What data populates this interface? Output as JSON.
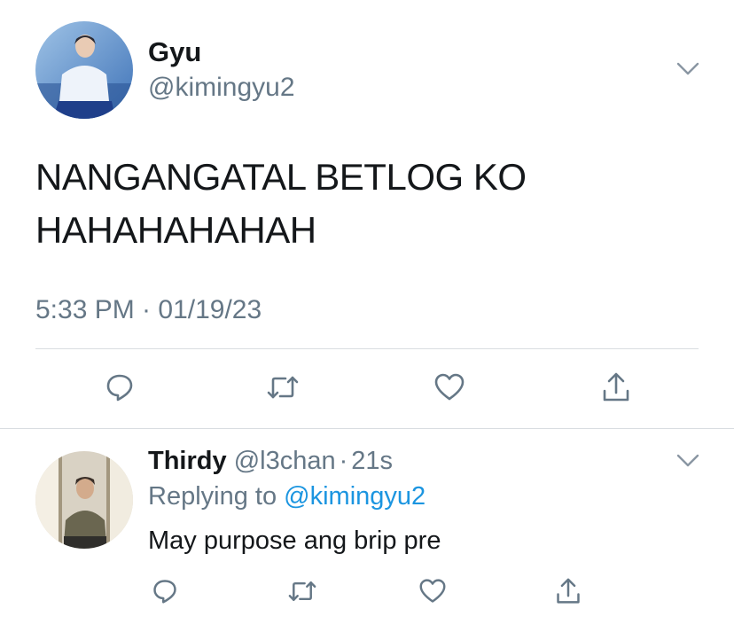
{
  "main_tweet": {
    "display_name": "Gyu",
    "handle": "@kimingyu2",
    "text_line1": "NANGANGATAL BETLOG KO",
    "text_line2": "HAHAHAHAHAH",
    "timestamp": "5:33 PM · 01/19/23",
    "actions": [
      "reply-icon",
      "retweet-icon",
      "like-icon",
      "share-icon"
    ]
  },
  "reply": {
    "display_name": "Thirdy",
    "handle": "@l3chan",
    "separator": "·",
    "age": "21s",
    "replying_prefix": "Replying to",
    "replying_handle": "@kimingyu2",
    "text": "May purpose ang brip pre",
    "actions": [
      "reply-icon",
      "retweet-icon",
      "like-icon",
      "share-icon"
    ]
  },
  "colors": {
    "text": "#14171a",
    "secondary": "#657786",
    "link": "#1b95e0",
    "divider": "#d9dde1"
  }
}
